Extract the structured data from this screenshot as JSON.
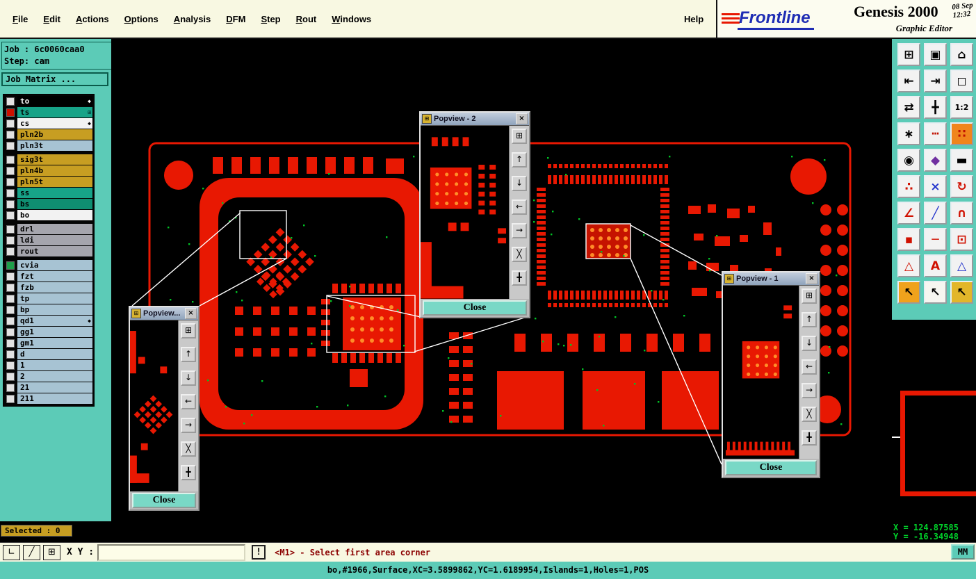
{
  "menu": {
    "items": [
      "File",
      "Edit",
      "Actions",
      "Options",
      "Analysis",
      "DFM",
      "Step",
      "Rout",
      "Windows"
    ],
    "help": "Help"
  },
  "brand": {
    "logo": "Frontline",
    "product": "Genesis 2000",
    "date": "08 Sep",
    "time": "12:32",
    "subtitle": "Graphic Editor"
  },
  "job": {
    "job_line": "Job : 6c0060caa0",
    "step_line": "Step: cam",
    "matrix_button": "Job Matrix ..."
  },
  "layers": [
    {
      "name": "to",
      "bg": "#000000",
      "fg": "#ffffff",
      "marker": "◆",
      "marker_color": "#ffffff"
    },
    {
      "name": "ts",
      "bg": "#17a388",
      "fg": "#000000",
      "checkbox": "#cc1100",
      "marker": "⊞",
      "marker_color": "#003333"
    },
    {
      "name": "cs",
      "bg": "#f2f2f2",
      "fg": "#000000",
      "marker": "◆",
      "marker_color": "#000000"
    },
    {
      "name": "pln2b",
      "bg": "#c79e22",
      "fg": "#000000"
    },
    {
      "name": "pln3t",
      "bg": "#a7c3d3",
      "fg": "#000000"
    },
    {
      "name": "sig3t",
      "bg": "#c79e22",
      "fg": "#000000",
      "gap_before": true
    },
    {
      "name": "pln4b",
      "bg": "#c79e22",
      "fg": "#000000"
    },
    {
      "name": "pln5t",
      "bg": "#c79e22",
      "fg": "#000000"
    },
    {
      "name": "ss",
      "bg": "#17a388",
      "fg": "#000000"
    },
    {
      "name": "bs",
      "bg": "#0f8e71",
      "fg": "#000000"
    },
    {
      "name": "bo",
      "bg": "#f2f2f2",
      "fg": "#000000"
    },
    {
      "name": "drl",
      "bg": "#a5a5ad",
      "fg": "#000000",
      "gap_before": true
    },
    {
      "name": "ldi",
      "bg": "#a5a5ad",
      "fg": "#000000"
    },
    {
      "name": "rout",
      "bg": "#a5a5ad",
      "fg": "#000000"
    },
    {
      "name": "cvia",
      "bg": "#a7c3d3",
      "fg": "#000000",
      "checkbox": "#1f9e4a",
      "gap_before": true
    },
    {
      "name": "fzt",
      "bg": "#a7c3d3",
      "fg": "#000000"
    },
    {
      "name": "fzb",
      "bg": "#a7c3d3",
      "fg": "#000000"
    },
    {
      "name": "tp",
      "bg": "#a7c3d3",
      "fg": "#000000"
    },
    {
      "name": "bp",
      "bg": "#a7c3d3",
      "fg": "#000000"
    },
    {
      "name": "qd1",
      "bg": "#a7c3d3",
      "fg": "#000000",
      "marker": "◆",
      "marker_color": "#000000"
    },
    {
      "name": "gg1",
      "bg": "#a7c3d3",
      "fg": "#000000"
    },
    {
      "name": "gm1",
      "bg": "#a7c3d3",
      "fg": "#000000"
    },
    {
      "name": "d",
      "bg": "#a7c3d3",
      "fg": "#000000"
    },
    {
      "name": "1",
      "bg": "#a7c3d3",
      "fg": "#000000"
    },
    {
      "name": "2",
      "bg": "#a7c3d3",
      "fg": "#000000"
    },
    {
      "name": "21",
      "bg": "#a7c3d3",
      "fg": "#000000"
    },
    {
      "name": "211",
      "bg": "#a7c3d3",
      "fg": "#000000"
    }
  ],
  "toolbar": {
    "buttons": [
      {
        "name": "clipboard",
        "icon": "⊞"
      },
      {
        "name": "screen",
        "icon": "▣"
      },
      {
        "name": "home-view",
        "icon": "⌂"
      },
      {
        "name": "pan-left",
        "icon": "⇤"
      },
      {
        "name": "pan-right",
        "icon": "⇥"
      },
      {
        "name": "zoom-area",
        "icon": "◻"
      },
      {
        "name": "swap-view",
        "icon": "⇄"
      },
      {
        "name": "center-view",
        "icon": "╋"
      },
      {
        "name": "zoom-1-2",
        "icon": "1:2",
        "small": true
      },
      {
        "name": "setup-tools",
        "icon": "∗"
      },
      {
        "name": "measure-points",
        "icon": "┅",
        "fg": "#c01000"
      },
      {
        "name": "snap-grid",
        "icon": "∷",
        "fg": "#c01000",
        "bg": "#f0851c"
      },
      {
        "name": "select-circle",
        "icon": "◉"
      },
      {
        "name": "view-3d",
        "icon": "◆",
        "fg": "#7030a0"
      },
      {
        "name": "ruler",
        "icon": "▬"
      },
      {
        "name": "net-points",
        "icon": "∴",
        "fg": "#d01000"
      },
      {
        "name": "delete",
        "icon": "×",
        "fg": "#2233cc"
      },
      {
        "name": "rotate",
        "icon": "↻",
        "fg": "#d01000"
      },
      {
        "name": "angle",
        "icon": "∠",
        "fg": "#d01000"
      },
      {
        "name": "slope-line",
        "icon": "╱",
        "fg": "#2233cc"
      },
      {
        "name": "arc",
        "icon": "∩",
        "fg": "#d01000"
      },
      {
        "name": "pad",
        "icon": "▪",
        "fg": "#d01000"
      },
      {
        "name": "line",
        "icon": "─",
        "fg": "#d01000"
      },
      {
        "name": "surface",
        "icon": "⊡",
        "fg": "#d01000"
      },
      {
        "name": "triangle-outline",
        "icon": "△",
        "fg": "#d01000"
      },
      {
        "name": "text-mark",
        "icon": "A",
        "fg": "#d01000"
      },
      {
        "name": "triangle-select",
        "icon": "△",
        "fg": "#2233cc"
      },
      {
        "name": "cursor-select",
        "icon": "↖",
        "bg": "#f0a21c"
      },
      {
        "name": "cursor-add",
        "icon": "↖",
        "bg": "#f6f6f0"
      },
      {
        "name": "cursor-mode",
        "icon": "↖",
        "bg": "#e2b62a"
      }
    ]
  },
  "popview_tools": [
    {
      "name": "duplicate",
      "icon": "⊞"
    },
    {
      "name": "pan-up",
      "icon": "↑"
    },
    {
      "name": "pan-down",
      "icon": "↓"
    },
    {
      "name": "pan-left",
      "icon": "←"
    },
    {
      "name": "pan-right",
      "icon": "→"
    },
    {
      "name": "zoom-out",
      "icon": "╳"
    },
    {
      "name": "zoom-center",
      "icon": "╋"
    }
  ],
  "popviews": [
    {
      "title": "Popview - 2",
      "close_label": "Close"
    },
    {
      "title": "Popview...",
      "close_label": "Close"
    },
    {
      "title": "Popview - 1",
      "close_label": "Close"
    }
  ],
  "overview_coords": {
    "x": "X = 124.87585",
    "y": "Y = -16.34948"
  },
  "selected": "Selected : 0",
  "statusbar": {
    "mode_buttons": [
      {
        "name": "corner",
        "icon": "∟"
      },
      {
        "name": "slope",
        "icon": "╱"
      },
      {
        "name": "grid",
        "icon": "⊞"
      }
    ],
    "xy_label": "X Y :",
    "input_value": "",
    "alert": "!",
    "message": "<M1> - Select first area corner",
    "units": "MM"
  },
  "infobar": "bo,#1966,Surface,XC=3.5899862,YC=1.6189954,Islands=1,Holes=1,POS"
}
